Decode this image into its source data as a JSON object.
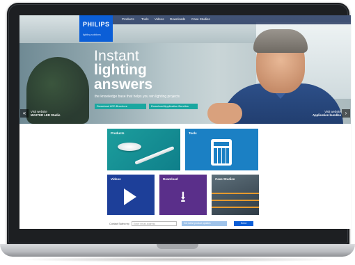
{
  "brand": {
    "logo": "PHILIPS",
    "tagline": "lighting solutions"
  },
  "nav": {
    "items": [
      "Products",
      "Tools",
      "Videos",
      "Downloads",
      "Case Studies"
    ]
  },
  "hero": {
    "line1": "Instant",
    "line2": "lighting",
    "line3": "answers",
    "subtitle": "the knowledge base that helps you win lighting projects",
    "button_brochure": "Download LED Brochure",
    "button_bundle": "Download Application Bundles",
    "left_link_l1": "Visit website",
    "left_link_l2": "MASTER LED Studio",
    "right_link_l1": "Visit website",
    "right_link_l2": "Application bundles",
    "left_arrow": "«",
    "right_arrow": "›"
  },
  "tiles": {
    "products": "Products",
    "tools": "Tools",
    "videos": "Videos",
    "download": "Download",
    "case_studies": "Case Studies"
  },
  "footer": {
    "newsletter_label": "Contact Sales rep",
    "email_placeholder": "Enter email address",
    "request_label": "Get latest product updates",
    "send_label": "Send"
  },
  "icons": [
    "play-icon",
    "download-icon",
    "calculator-icon",
    "led-disc-icon",
    "led-tube-icon",
    "arrow-left-icon",
    "arrow-right-icon"
  ]
}
